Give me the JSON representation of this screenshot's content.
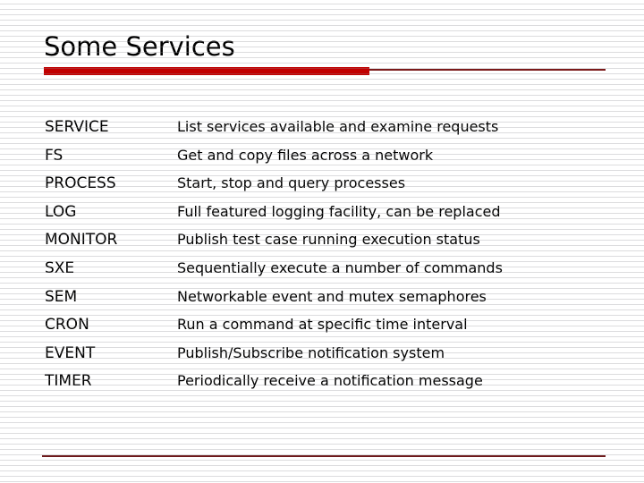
{
  "slide": {
    "title": "Some Services",
    "accent_color": "#C20000",
    "rule_color": "#7B1A1A",
    "footer_rule_color": "#6E1A1C",
    "background_color": "#FFFFFF",
    "text_color": "#000000"
  },
  "services": [
    {
      "name": "SERVICE",
      "description": "List services available and examine requests"
    },
    {
      "name": "FS",
      "description": "Get and copy files across a network"
    },
    {
      "name": "PROCESS",
      "description": "Start, stop and query processes"
    },
    {
      "name": "LOG",
      "description": "Full featured logging facility, can be replaced"
    },
    {
      "name": "MONITOR",
      "description": "Publish test case running execution status"
    },
    {
      "name": "SXE",
      "description": "Sequentially execute a number of commands"
    },
    {
      "name": "SEM",
      "description": "Networkable event and mutex semaphores"
    },
    {
      "name": "CRON",
      "description": "Run a command at specific time interval"
    },
    {
      "name": "EVENT",
      "description": "Publish/Subscribe notification system"
    },
    {
      "name": "TIMER",
      "description": "Periodically receive a notification message"
    }
  ]
}
